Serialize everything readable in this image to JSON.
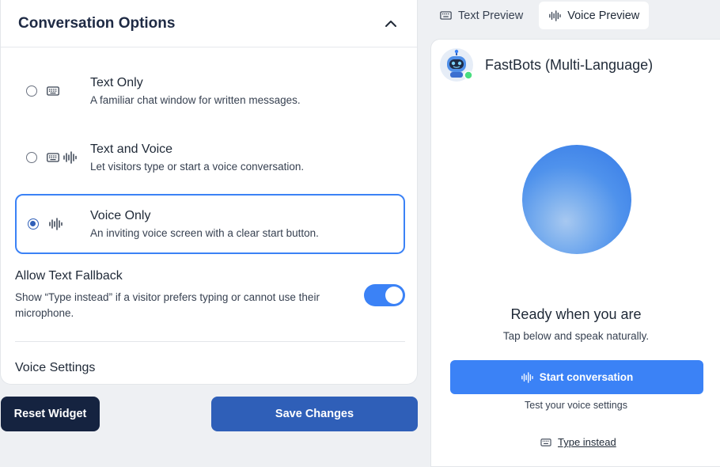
{
  "settings": {
    "title": "Conversation Options",
    "options": [
      {
        "label": "Text Only",
        "desc": "A familiar chat window for written messages.",
        "selected": false
      },
      {
        "label": "Text and Voice",
        "desc": "Let visitors type or start a voice conversation.",
        "selected": false
      },
      {
        "label": "Voice Only",
        "desc": "An inviting voice screen with a clear start button.",
        "selected": true
      }
    ],
    "fallback": {
      "title": "Allow Text Fallback",
      "desc": "Show “Type instead” if a visitor prefers typing or cannot use their microphone.",
      "enabled": true
    },
    "voice_settings_title": "Voice Settings"
  },
  "actions": {
    "reset_label": "Reset Widget",
    "save_label": "Save Changes"
  },
  "preview": {
    "tabs": [
      {
        "label": "Text Preview",
        "icon": "keyboard-icon",
        "active": false
      },
      {
        "label": "Voice Preview",
        "icon": "waveform-icon",
        "active": true
      }
    ],
    "bot_name": "FastBots (Multi-Language)",
    "ready_title": "Ready when you are",
    "ready_sub": "Tap below and speak naturally.",
    "start_label": "Start conversation",
    "test_text": "Test your voice settings",
    "type_instead_label": "Type instead"
  },
  "colors": {
    "accent": "#3b82f6",
    "primary_dark": "#152340",
    "save_blue": "#2f5fb8",
    "online_green": "#4ade80"
  }
}
